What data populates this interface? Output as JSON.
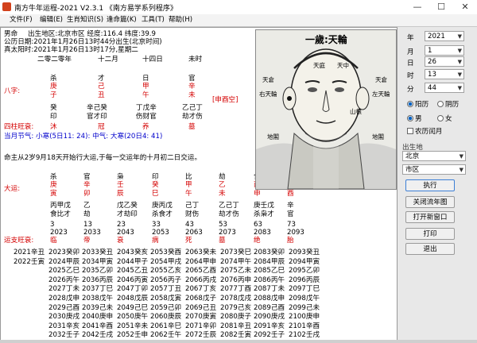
{
  "window": {
    "title": "南方牛年运程-2021  V2.3.1  《南方易学系列程序》",
    "min": "—",
    "max": "☐",
    "close": "✕"
  },
  "menu": [
    "文件(F)",
    "编辑(E)",
    "生肖知识(S)",
    "逢命篇(K)",
    "工具(T)",
    "帮助(H)"
  ],
  "header": {
    "gender": "男命",
    "birthplace": "出生地区:北京市区  经度:116.4 纬度:39.9",
    "solar": "公历日期:2021年1月26日13时44分出生(北京时间)",
    "truesolar": "真太阳时:2021年1月26日13时17分,星期二",
    "cols": [
      "二零二零年",
      "十二月",
      "十四日",
      "未时"
    ]
  },
  "bazi": {
    "shishen": [
      "杀",
      "才",
      "日",
      "官"
    ],
    "label": "八字:",
    "gan": [
      "庚",
      "己",
      "甲",
      "辛"
    ],
    "zhi": [
      "子",
      "丑",
      "午",
      "未"
    ],
    "kongwang": "[申酉空]",
    "canggan": [
      "癸",
      "辛己癸",
      "丁戊辛",
      "乙己丁"
    ],
    "cangshen": [
      "印",
      "官才印",
      "伤财官",
      "劫才伤"
    ],
    "wangshuai_label": "四柱旺衰:",
    "wangshuai": [
      "沐",
      "冠",
      "养",
      "墓"
    ],
    "jieqi": "当月节气: 小寒(5日11: 24): 中气: 大寒(20日4: 41)"
  },
  "dayun": {
    "start": "命主从2岁9月18天开始行大运,于每一交运年的十月初二日交运。",
    "label": "大运:",
    "shishen": [
      "杀",
      "官",
      "枭",
      "印",
      "比",
      "劫",
      "食",
      "伤"
    ],
    "gan": [
      "庚",
      "辛",
      "壬",
      "癸",
      "甲",
      "乙",
      "丙",
      "丁"
    ],
    "zhi": [
      "寅",
      "卯",
      "辰",
      "巳",
      "午",
      "未",
      "申",
      "酉"
    ],
    "canggan": [
      "丙甲戊",
      "乙",
      "戊乙癸",
      "庚丙戊",
      "己丁",
      "乙己丁",
      "庚壬戊",
      "辛"
    ],
    "cangshen": [
      "食比才",
      "劫",
      "才劫印",
      "杀食才",
      "财伤",
      "劫才伤",
      "杀枭才",
      "官"
    ],
    "ages": [
      "3",
      "13",
      "23",
      "33",
      "43",
      "53",
      "63",
      "73"
    ],
    "years": [
      "2023",
      "2033",
      "2043",
      "2053",
      "2063",
      "2073",
      "2083",
      "2093"
    ],
    "ws_label": "运支旺衰:",
    "wangshuai": [
      "临",
      "帝",
      "衰",
      "病",
      "死",
      "墓",
      "绝",
      "胎"
    ]
  },
  "liunian": [
    [
      "2021辛丑",
      "2023癸卯",
      "2033癸丑",
      "2043癸亥",
      "2053癸酉",
      "2063癸未",
      "2073癸巳",
      "2083癸卯",
      "2093癸丑"
    ],
    [
      "2022壬寅",
      "2024甲辰",
      "2034甲寅",
      "2044甲子",
      "2054甲戌",
      "2064甲申",
      "2074甲午",
      "2084甲辰",
      "2094甲寅"
    ],
    [
      "",
      "2025乙巳",
      "2035乙卯",
      "2045乙丑",
      "2055乙亥",
      "2065乙酉",
      "2075乙未",
      "2085乙巳",
      "2095乙卯"
    ],
    [
      "",
      "2026丙午",
      "2036丙辰",
      "2046丙寅",
      "2056丙子",
      "2066丙戌",
      "2076丙申",
      "2086丙午",
      "2096丙辰"
    ],
    [
      "",
      "2027丁未",
      "2037丁巳",
      "2047丁卯",
      "2057丁丑",
      "2067丁亥",
      "2077丁酉",
      "2087丁未",
      "2097丁巳"
    ],
    [
      "",
      "2028戊申",
      "2038戊午",
      "2048戊辰",
      "2058戊寅",
      "2068戊子",
      "2078戊戌",
      "2088戊申",
      "2098戊午"
    ],
    [
      "",
      "2029己酉",
      "2039己未",
      "2049己巳",
      "2059己卯",
      "2069己丑",
      "2079己亥",
      "2089己酉",
      "2099己未"
    ],
    [
      "",
      "2030庚戌",
      "2040庚申",
      "2050庚午",
      "2060庚辰",
      "2070庚寅",
      "2080庚子",
      "2090庚戌",
      "2100庚申"
    ],
    [
      "",
      "2031辛亥",
      "2041辛酉",
      "2051辛未",
      "2061辛巳",
      "2071辛卯",
      "2081辛丑",
      "2091辛亥",
      "2101辛酉"
    ],
    [
      "",
      "2032壬子",
      "2042壬戌",
      "2052壬申",
      "2062壬午",
      "2072壬辰",
      "2082壬寅",
      "2092壬子",
      "2102壬戌"
    ]
  ],
  "face": {
    "title": "一歲:天輪",
    "labels": [
      "天倉",
      "天庭",
      "天中",
      "天倉",
      "右天輪",
      "左天輪",
      "山根",
      "地閣",
      "地閣"
    ]
  },
  "panel": {
    "year_label": "年",
    "year": "2021",
    "month_label": "月",
    "month": "1",
    "day_label": "日",
    "day": "26",
    "hour_label": "时",
    "hour": "13",
    "minute_label": "分",
    "minute": "44",
    "cal_solar": "阳历",
    "cal_lunar": "阴历",
    "male": "男",
    "female": "女",
    "leap": "农历闰月",
    "region_label": "出生地",
    "province": "北京",
    "district": "市区",
    "buttons": [
      "执行",
      "关闭流年图",
      "打开新窗口",
      "打印",
      "退出"
    ]
  }
}
